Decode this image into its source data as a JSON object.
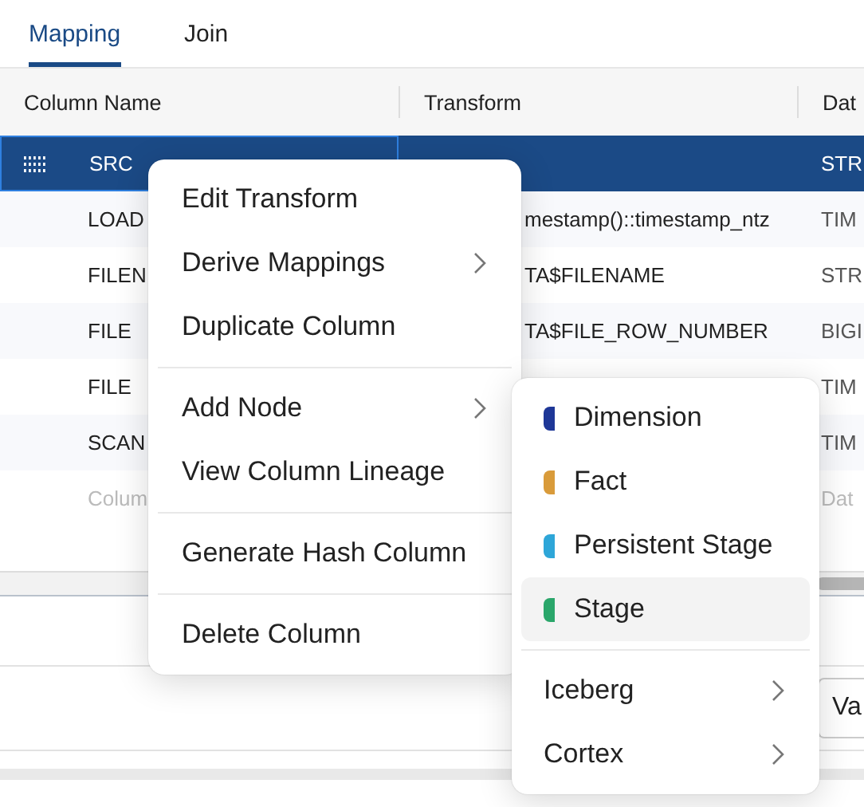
{
  "tabs": [
    {
      "label": "Mapping",
      "selected": true
    },
    {
      "label": "Join",
      "selected": false
    }
  ],
  "table": {
    "columns": [
      "Column Name",
      "Transform",
      "Dat"
    ],
    "rows": [
      {
        "kind": "column",
        "selected": true,
        "name": "SRC",
        "transform": "",
        "data_type": "STR"
      },
      {
        "kind": "column",
        "selected": false,
        "name": "LOAD",
        "transform": "mestamp()::timestamp_ntz",
        "data_type": "TIM"
      },
      {
        "kind": "column",
        "selected": false,
        "name": "FILEN",
        "transform": "TA$FILENAME",
        "data_type": "STR"
      },
      {
        "kind": "column",
        "selected": false,
        "name": "FILE",
        "transform": "TA$FILE_ROW_NUMBER",
        "data_type": "BIGI"
      },
      {
        "kind": "column",
        "selected": false,
        "name": "FILE",
        "transform": "",
        "data_type": "TIM"
      },
      {
        "kind": "column",
        "selected": false,
        "name": "SCAN",
        "transform": "",
        "data_type": "TIM"
      },
      {
        "kind": "placeholder",
        "selected": false,
        "name": "Colum",
        "transform": "",
        "data_type": "Dat"
      }
    ]
  },
  "side_button": "Va",
  "context_menu": {
    "groups": [
      [
        {
          "label": "Edit Transform",
          "submenu": false
        },
        {
          "label": "Derive Mappings",
          "submenu": true
        },
        {
          "label": "Duplicate Column",
          "submenu": false
        }
      ],
      [
        {
          "label": "Add Node",
          "submenu": true
        },
        {
          "label": "View Column Lineage",
          "submenu": false
        }
      ],
      [
        {
          "label": "Generate Hash Column",
          "submenu": false
        }
      ],
      [
        {
          "label": "Delete Column",
          "submenu": false
        }
      ]
    ]
  },
  "submenu": {
    "groups": [
      [
        {
          "label": "Dimension",
          "color": "#1e3797",
          "selected": false,
          "submenu": false
        },
        {
          "label": "Fact",
          "color": "#d99b3a",
          "selected": false,
          "submenu": false
        },
        {
          "label": "Persistent Stage",
          "color": "#2ea6d8",
          "selected": false,
          "submenu": false
        },
        {
          "label": "Stage",
          "color": "#2aa66a",
          "selected": true,
          "submenu": false
        }
      ],
      [
        {
          "label": "Iceberg",
          "selected": false,
          "submenu": true
        },
        {
          "label": "Cortex",
          "selected": false,
          "submenu": true
        }
      ]
    ]
  }
}
